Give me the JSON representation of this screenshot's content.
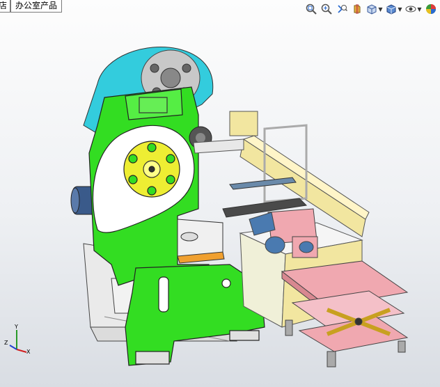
{
  "document_tabs": [
    {
      "label": "店"
    },
    {
      "label": "办公室产品"
    }
  ],
  "heads_up_toolbar": {
    "tools": [
      {
        "name": "zoom-to-fit",
        "icon": "zoom-fit-icon"
      },
      {
        "name": "zoom-to-area",
        "icon": "zoom-area-icon"
      },
      {
        "name": "previous-view",
        "icon": "previous-view-icon"
      },
      {
        "name": "section-view",
        "icon": "section-view-icon"
      },
      {
        "name": "view-orientation",
        "icon": "view-orientation-icon"
      },
      {
        "name": "display-style",
        "icon": "display-style-icon"
      },
      {
        "name": "hide-show-items",
        "icon": "hide-show-icon"
      },
      {
        "name": "appearance",
        "icon": "appearance-icon"
      }
    ]
  },
  "triad": {
    "x_label": "X",
    "y_label": "Y",
    "z_label": "Z"
  },
  "colors": {
    "frame_green": "#33dd22",
    "flywheel_cyan": "#33ccdd",
    "gear_yellow": "#eeee33",
    "feeder_pink": "#f0a8b0",
    "beam_tan": "#f2e6a0",
    "frame_grey": "#e8e8e8",
    "motor_blue": "#4a7ab0"
  }
}
